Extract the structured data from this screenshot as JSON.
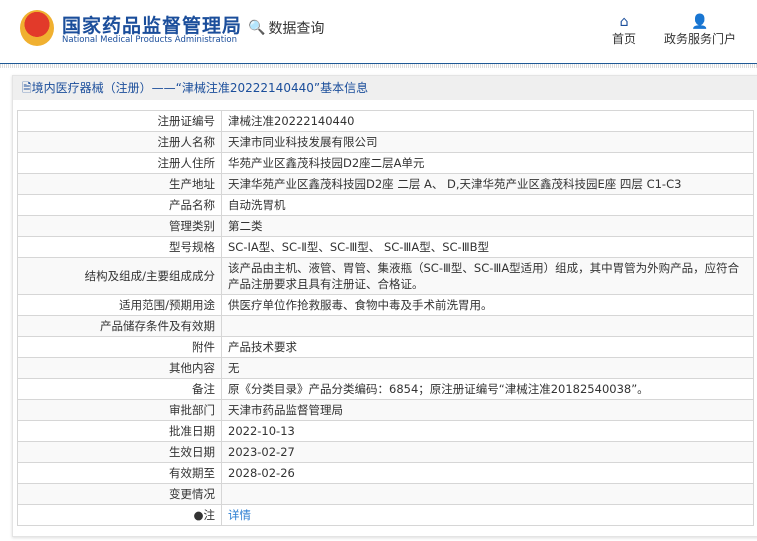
{
  "header": {
    "logo_cn": "国家药品监督管理局",
    "logo_en": "National Medical Products Administration",
    "query": "数据查询",
    "nav": [
      {
        "label": "首页",
        "icon": "home-icon"
      },
      {
        "label": "政务服务门户",
        "icon": "user-icon"
      }
    ]
  },
  "title": "境内医疗器械（注册）——“津械注准20222140440”基本信息",
  "rows": [
    {
      "label": "注册证编号",
      "value": "津械注准20222140440"
    },
    {
      "label": "注册人名称",
      "value": "天津市同业科技发展有限公司"
    },
    {
      "label": "注册人住所",
      "value": "华苑产业区鑫茂科技园D2座二层A单元"
    },
    {
      "label": "生产地址",
      "value": "天津华苑产业区鑫茂科技园D2座 二层 A、 D,天津华苑产业区鑫茂科技园E座 四层 C1-C3"
    },
    {
      "label": "产品名称",
      "value": "自动洗胃机"
    },
    {
      "label": "管理类别",
      "value": "第二类"
    },
    {
      "label": "型号规格",
      "value": "SC-ⅠA型、SC-Ⅱ型、SC-Ⅲ型、 SC-ⅢA型、SC-ⅢB型"
    },
    {
      "label": "结构及组成/主要组成成分",
      "value": "该产品由主机、液管、胃管、集液瓶（SC-Ⅲ型、SC-ⅢA型适用）组成，其中胃管为外购产品，应符合产品注册要求且具有注册证、合格证。"
    },
    {
      "label": "适用范围/预期用途",
      "value": "供医疗单位作抢救服毒、食物中毒及手术前洗胃用。"
    },
    {
      "label": "产品储存条件及有效期",
      "value": ""
    },
    {
      "label": "附件",
      "value": "产品技术要求"
    },
    {
      "label": "其他内容",
      "value": "无"
    },
    {
      "label": "备注",
      "value": "原《分类目录》产品分类编码：6854；原注册证编号“津械注准20182540038”。"
    },
    {
      "label": "审批部门",
      "value": "天津市药品监督管理局"
    },
    {
      "label": "批准日期",
      "value": "2022-10-13"
    },
    {
      "label": "生效日期",
      "value": "2023-02-27"
    },
    {
      "label": "有效期至",
      "value": "2028-02-26"
    },
    {
      "label": "变更情况",
      "value": ""
    }
  ],
  "note": {
    "label": "注",
    "link": "详情"
  }
}
